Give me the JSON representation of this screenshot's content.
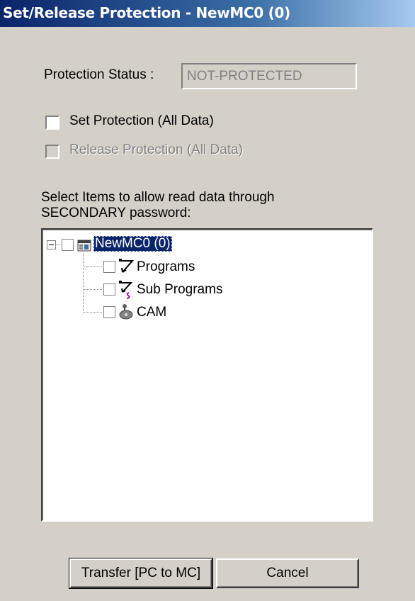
{
  "window": {
    "title": "Set/Release Protection - NewMC0 (0)"
  },
  "status": {
    "label": "Protection Status :",
    "value": "NOT-PROTECTED"
  },
  "options": {
    "set_protection": {
      "label": "Set Protection (All Data)",
      "checked": false
    },
    "release_protection": {
      "label": "Release Protection (All Data)",
      "checked": false,
      "enabled": false
    }
  },
  "instructions": {
    "line1": "Select Items to allow read data through",
    "line2": "SECONDARY password:"
  },
  "tree": {
    "root": {
      "label": "NewMC0 (0)",
      "icon": "machine-icon",
      "checked": false,
      "expanded": true
    },
    "children": [
      {
        "label": "Programs",
        "icon": "programs-icon",
        "checked": false
      },
      {
        "label": "Sub Programs",
        "icon": "sub-programs-icon",
        "checked": false
      },
      {
        "label": "CAM",
        "icon": "cam-icon",
        "checked": false
      }
    ]
  },
  "buttons": {
    "transfer": "Transfer [PC to MC]",
    "cancel": "Cancel"
  }
}
